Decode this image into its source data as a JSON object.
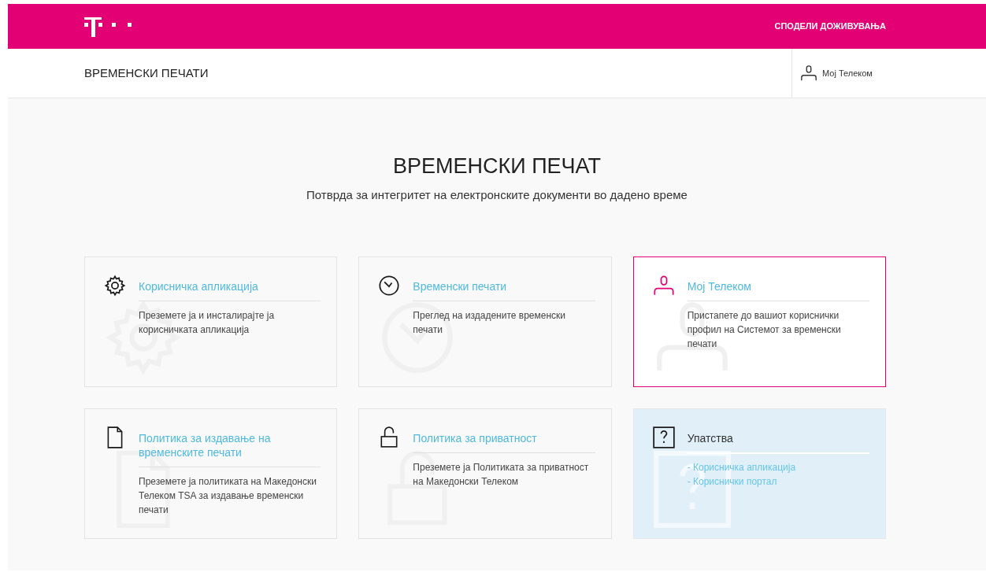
{
  "top_bar": {
    "link": "СПОДЕЛИ ДОЖИВУВАЊА"
  },
  "sub_header": {
    "title": "ВРЕМЕНСКИ ПЕЧАТИ",
    "account": "Мој Телеком"
  },
  "hero": {
    "title": "ВРЕМЕНСКИ ПЕЧАТ",
    "subtitle": "Потврда за интегритет на електронските документи во дадено време"
  },
  "cards": [
    {
      "kind": "link",
      "highlighted": false,
      "title": "Корисничка апликација",
      "text": "Преземете ја и инсталирајте ја корисничката апликација"
    },
    {
      "kind": "link",
      "highlighted": false,
      "title": "Временски печати",
      "text": "Преглед на издадените временски печати"
    },
    {
      "kind": "link",
      "highlighted": true,
      "title": "Мој Телеком",
      "text": "Пристапете до вашиот кориснички профил на Системот за временски печати"
    },
    {
      "kind": "link",
      "highlighted": false,
      "title": "Политика за издавање на временските печати",
      "text": "Преземете ја политиката на Македонски Телеком TSA за издавање временски печати"
    },
    {
      "kind": "link",
      "highlighted": false,
      "title": "Политика за приватност",
      "text": "Преземете ја Политиката за приватност на Македонски Телеком"
    },
    {
      "kind": "help",
      "highlighted": false,
      "title": "Упатства",
      "links": [
        "- Корисничка апликација",
        "- Кориснички портал"
      ]
    }
  ]
}
